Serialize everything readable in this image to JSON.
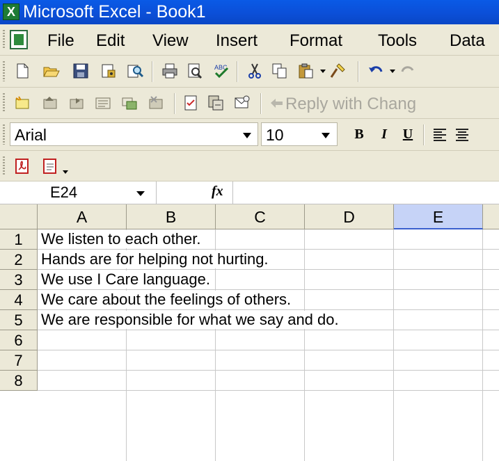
{
  "window": {
    "title": "Microsoft Excel - Book1"
  },
  "menu": {
    "items": [
      "File",
      "Edit",
      "View",
      "Insert",
      "Format",
      "Tools",
      "Data"
    ]
  },
  "toolbar_review": {
    "reply_label": "Reply with Chang"
  },
  "format_bar": {
    "font_name": "Arial",
    "font_size": "10",
    "bold": "B",
    "italic": "I",
    "underline": "U"
  },
  "formula_bar": {
    "name_box": "E24",
    "fx": "fx",
    "formula": ""
  },
  "sheet": {
    "columns": [
      "A",
      "B",
      "C",
      "D",
      "E"
    ],
    "selected_column": "E",
    "rows": [
      "1",
      "2",
      "3",
      "4",
      "5",
      "6",
      "7",
      "8"
    ],
    "cells_col_a": [
      "We listen to each other.",
      "Hands are for helping not hurting.",
      "We use I Care language.",
      "We care about the feelings of others.",
      "We are responsible for what we say and do.",
      "",
      "",
      ""
    ]
  },
  "icons": {
    "standard": [
      "new-icon",
      "open-icon",
      "save-icon",
      "permission-icon",
      "research-icon",
      "print-icon",
      "print-preview-icon",
      "spelling-icon",
      "cut-icon",
      "copy-icon",
      "paste-icon",
      "format-painter-icon",
      "undo-icon",
      "redo-icon"
    ],
    "reviewing": [
      "new-comment-icon",
      "previous-comment-icon",
      "next-comment-icon",
      "show-comment-icon",
      "show-all-comments-icon",
      "delete-comment-icon",
      "track-changes-icon",
      "update-file-icon",
      "send-recipient-icon"
    ],
    "pdf": [
      "convert-pdf-icon",
      "pdf-options-icon"
    ]
  },
  "colors": {
    "titlebar": "#0b4fd8",
    "chrome": "#ece9d8",
    "selected_header": "#c6d3f7"
  }
}
